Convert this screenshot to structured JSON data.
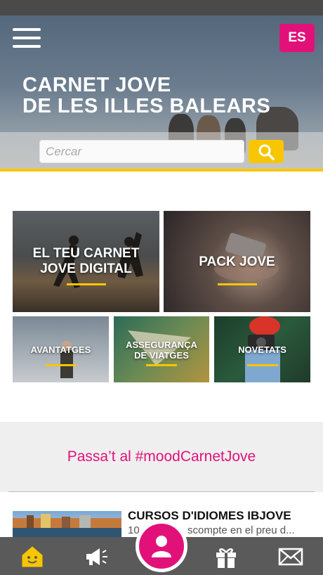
{
  "header": {
    "menu_icon": "hamburger-menu-icon",
    "lang_button": "ES",
    "title_line1": "CARNET JOVE",
    "title_line2": "DE LES ILLES BALEARS"
  },
  "search": {
    "placeholder": "Cercar",
    "icon": "search-icon"
  },
  "tiles": [
    {
      "label_line1": "EL TEU CARNET",
      "label_line2": "JOVE DIGITAL"
    },
    {
      "label_line1": "PACK JOVE"
    },
    {
      "label_line1": "AVANTATGES"
    },
    {
      "label_line1": "ASSEGURANÇA",
      "label_line2": "DE VIATGES"
    },
    {
      "label_line1": "NOVETATS"
    }
  ],
  "mood": {
    "text": "Passa’t al #moodCarnetJove"
  },
  "news": {
    "title": "CURSOS D'IDIOMES IBJOVE",
    "desc_left": "10",
    "desc_right": "scompte en el preu d..."
  },
  "bottom_nav": {
    "items": [
      "home-icon",
      "megaphone-icon",
      "profile-icon",
      "gift-icon",
      "mail-icon"
    ]
  },
  "colors": {
    "accent_pink": "#e2117a",
    "accent_yellow": "#f7c600",
    "nav_bg": "#5a5a5a"
  }
}
